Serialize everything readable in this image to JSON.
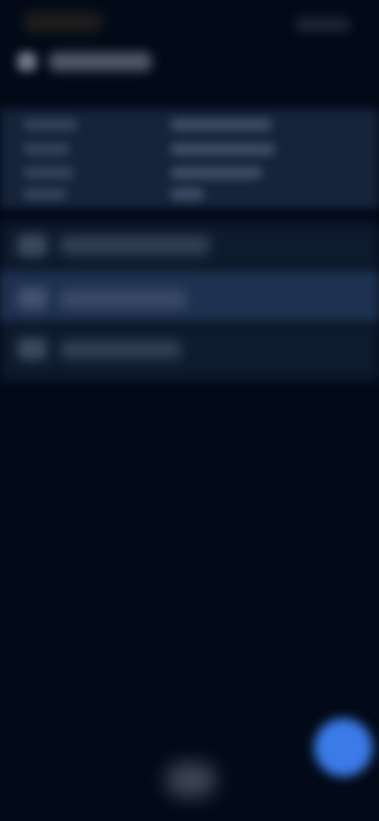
{
  "screen": {
    "background": "#020a18",
    "accent": "#3b7be8"
  },
  "icons": {
    "back": "back-arrow-icon",
    "option_1": "option-icon",
    "option_2": "option-icon",
    "option_3": "option-icon",
    "fab": "action-icon"
  },
  "content": {
    "status_time": "",
    "page_title": "",
    "info_labels": [
      "",
      "",
      "",
      ""
    ],
    "info_values": [
      "",
      "",
      "",
      ""
    ],
    "options": [
      "",
      "",
      ""
    ]
  }
}
